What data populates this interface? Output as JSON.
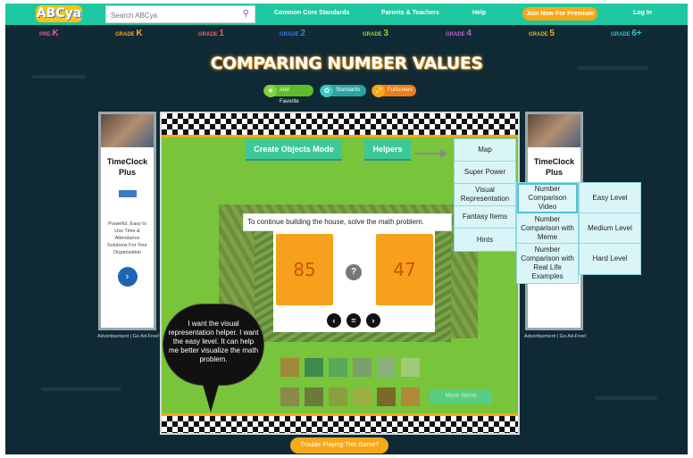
{
  "header": {
    "logo": "ABCya",
    "search_placeholder": "Search ABCya",
    "links": [
      "Common Core Standards",
      "Parents & Teachers",
      "Help"
    ],
    "premium_label": "Join Now For Premium",
    "login_label": "Log In"
  },
  "grades": [
    {
      "prefix": "PRE-",
      "big": "K",
      "color": "#ff4fa0"
    },
    {
      "prefix": "GRADE ",
      "big": "K",
      "color": "#f7a817"
    },
    {
      "prefix": "GRADE ",
      "big": "1",
      "color": "#ff5a5a"
    },
    {
      "prefix": "GRADE ",
      "big": "2",
      "color": "#3b7de0"
    },
    {
      "prefix": "GRADE ",
      "big": "3",
      "color": "#9bd13a"
    },
    {
      "prefix": "GRADE ",
      "big": "4",
      "color": "#c659d6"
    },
    {
      "prefix": "GRADE ",
      "big": "5",
      "color": "#f7a817"
    },
    {
      "prefix": "GRADE ",
      "big": "6+",
      "color": "#2dc6c6"
    }
  ],
  "title": "COMPARING NUMBER VALUES",
  "actions": {
    "favorite": "Add Favorite",
    "standards": "Standards",
    "fullscreen": "Fullscreen"
  },
  "ads": {
    "left": {
      "title": "TimeClock Plus",
      "text": "Powerful, Easy to Use Time & Attendance Solutions For Your Organization"
    },
    "right": {
      "title": "TimeClock Plus"
    },
    "caption": "Advertisement | Go Ad-Free!"
  },
  "game": {
    "create_objects": "Create Objects Mode",
    "helpers": "Helpers",
    "prompt": "To continue building the house, solve the math problem.",
    "left_number": "85",
    "right_number": "47",
    "compare_symbol": "?",
    "more_items": "More Items"
  },
  "speech_bubble": "I want the visual representation helper. I want the easy level. It can help me better visualize the math problem.",
  "helpers_menu": [
    "Map",
    "Super Power",
    "Visual Representation",
    "Fantasy Items",
    "Hints"
  ],
  "visual_submenu": [
    "Number Comparison Video",
    "Number Comparison with Meme",
    "Number Comparison with Real Life Examples"
  ],
  "level_menu": [
    "Easy Level",
    "Medium Level",
    "Hard Level"
  ],
  "trouble_label": "Trouble Playing This Game?",
  "colors": {
    "nav": "#1fc8a0",
    "background": "#0f2a35",
    "accent": "#f7a817",
    "game_green": "#78c43a"
  }
}
